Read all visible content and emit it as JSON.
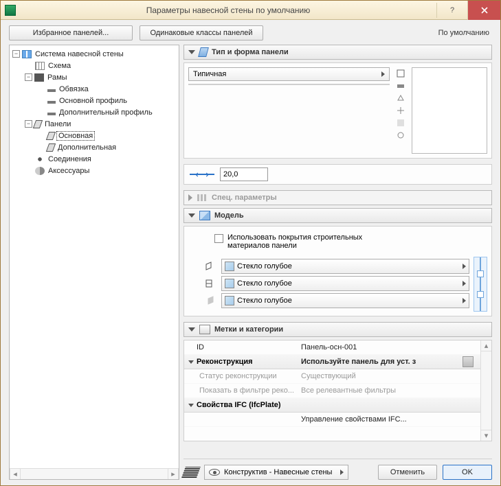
{
  "window": {
    "title": "Параметры навесной стены по умолчанию"
  },
  "toolbar": {
    "favorites": "Избранное панелей...",
    "uniform_classes": "Одинаковые классы панелей",
    "defaults": "По умолчанию"
  },
  "tree": {
    "root": "Система навесной стены",
    "items": [
      "Схема",
      "Рамы",
      "Обвязка",
      "Основной профиль",
      "Дополнительный профиль",
      "Панели",
      "Основная",
      "Дополнительная",
      "Соединения",
      "Аксессуары"
    ]
  },
  "panel_type": {
    "header": "Тип и форма панели",
    "dropdown": "Типичная",
    "thickness": "20,0"
  },
  "spec_params": {
    "header": "Спец. параметры"
  },
  "model": {
    "header": "Модель",
    "checkbox_label": "Использовать покрытия строительных материалов панели",
    "materials": [
      "Стекло голубое",
      "Стекло голубое",
      "Стекло голубое"
    ]
  },
  "labels": {
    "header": "Метки и категории",
    "rows": {
      "id_label": "ID",
      "id_value": "Панель-осн-001",
      "recon_label": "Реконструкция",
      "recon_value": "Используйте панель для уст. з",
      "status_label": "Статус реконструкции",
      "status_value": "Существующий",
      "filter_label": "Показать в фильтре реко...",
      "filter_value": "Все релевантные фильтры",
      "ifc_label": "Свойства IFC (IfcPlate)",
      "ifc_manage": "Управление свойствами IFC..."
    }
  },
  "footer": {
    "layer": "Конструктив - Навесные стены",
    "cancel": "Отменить",
    "ok": "OK"
  }
}
